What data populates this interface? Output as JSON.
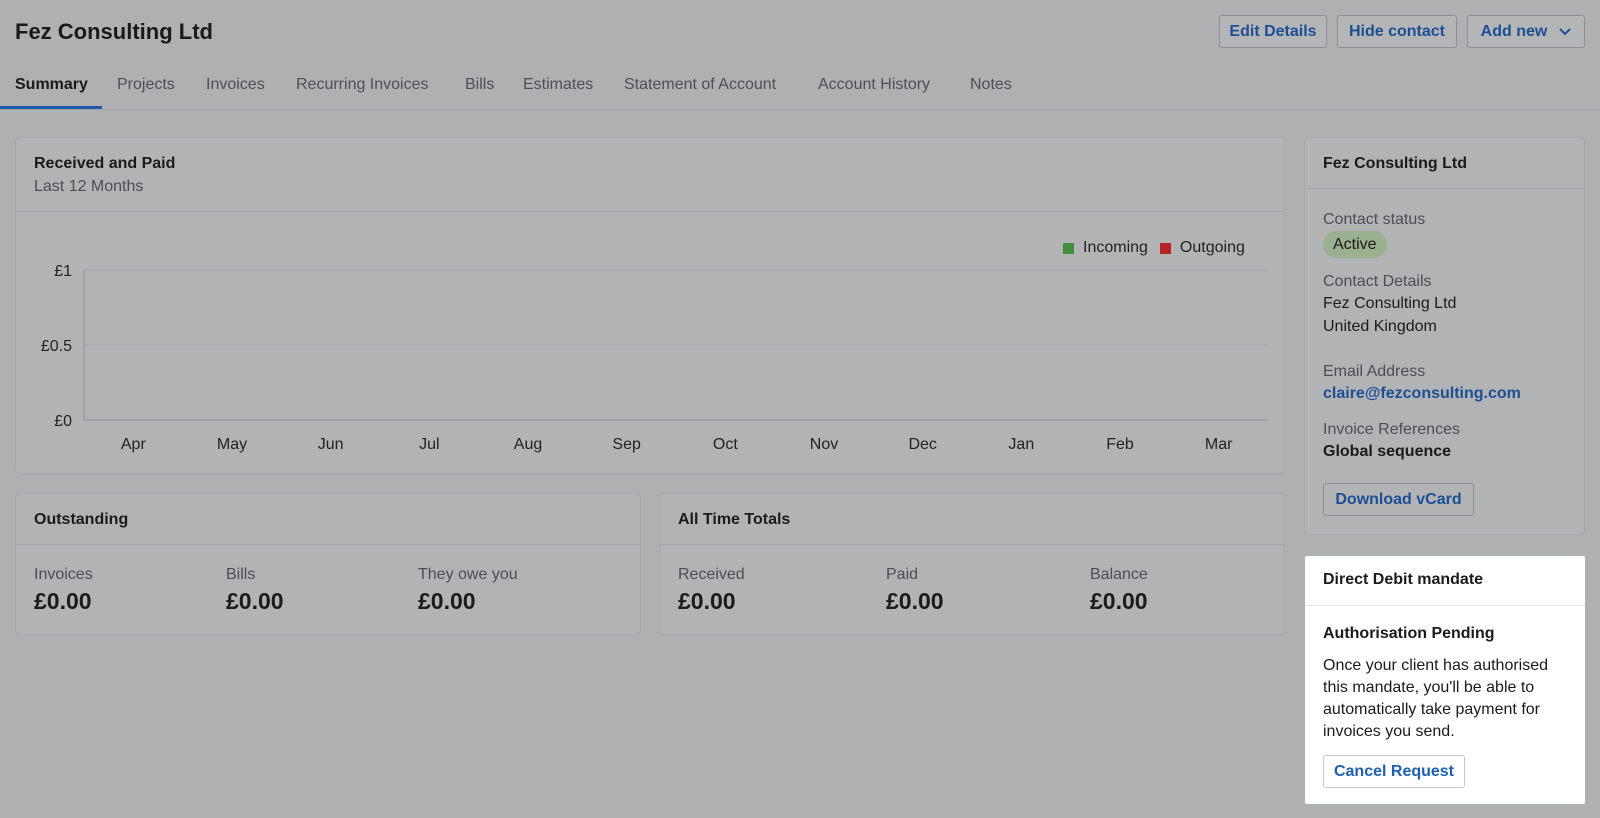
{
  "header": {
    "title": "Fez Consulting Ltd",
    "edit_details": "Edit Details",
    "hide_contact": "Hide contact",
    "add_new": "Add new"
  },
  "tabs": [
    {
      "label": "Summary",
      "active": true
    },
    {
      "label": "Projects"
    },
    {
      "label": "Invoices"
    },
    {
      "label": "Recurring Invoices"
    },
    {
      "label": "Bills"
    },
    {
      "label": "Estimates"
    },
    {
      "label": "Statement of Account"
    },
    {
      "label": "Account History"
    },
    {
      "label": "Notes"
    }
  ],
  "chart_card": {
    "title": "Received and Paid",
    "subtitle": "Last 12 Months"
  },
  "chart_data": {
    "type": "bar",
    "categories": [
      "Apr",
      "May",
      "Jun",
      "Jul",
      "Aug",
      "Sep",
      "Oct",
      "Nov",
      "Dec",
      "Jan",
      "Feb",
      "Mar"
    ],
    "series": [
      {
        "name": "Incoming",
        "color": "#3f8f3c",
        "values": [
          0,
          0,
          0,
          0,
          0,
          0,
          0,
          0,
          0,
          0,
          0,
          0
        ]
      },
      {
        "name": "Outgoing",
        "color": "#b42424",
        "values": [
          0,
          0,
          0,
          0,
          0,
          0,
          0,
          0,
          0,
          0,
          0,
          0
        ]
      }
    ],
    "yticks": [
      "£1",
      "£0.5",
      "£0"
    ],
    "ylim": [
      0,
      1
    ],
    "grid": true,
    "legend": "top-right"
  },
  "outstanding": {
    "title": "Outstanding",
    "invoices_label": "Invoices",
    "invoices_value": "£0.00",
    "bills_label": "Bills",
    "bills_value": "£0.00",
    "owe_label": "They owe you",
    "owe_value": "£0.00"
  },
  "totals": {
    "title": "All Time Totals",
    "received_label": "Received",
    "received_value": "£0.00",
    "paid_label": "Paid",
    "paid_value": "£0.00",
    "balance_label": "Balance",
    "balance_value": "£0.00"
  },
  "contact": {
    "title": "Fez Consulting Ltd",
    "status_label": "Contact status",
    "status": "Active",
    "details_label": "Contact Details",
    "details_line1": "Fez Consulting Ltd",
    "details_line2": "United Kingdom",
    "email_label": "Email Address",
    "email": "claire@fezconsulting.com",
    "refs_label": "Invoice References",
    "refs_value": "Global sequence",
    "download_vcard": "Download vCard"
  },
  "direct_debit": {
    "title": "Direct Debit mandate",
    "status": "Authorisation Pending",
    "line1": "Once your client has authorised",
    "line2": "this mandate, you'll be able to",
    "line3": "automatically take payment for",
    "line4": "invoices you send.",
    "cancel": "Cancel Request"
  }
}
